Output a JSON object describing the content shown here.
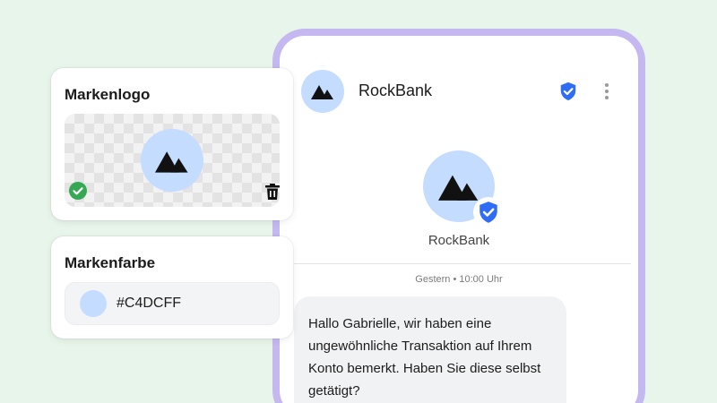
{
  "brand_logo_card": {
    "title": "Markenlogo"
  },
  "brand_color_card": {
    "title": "Markenfarbe",
    "value": "#C4DCFF"
  },
  "chat": {
    "header_name": "RockBank",
    "profile_name": "RockBank",
    "timestamp": "Gestern • 10:00 Uhr",
    "message": "Hallo Gabrielle, wir haben eine ungewöhnliche Transaktion auf Ihrem Konto bemerkt. Haben Sie diese selbst getätigt?"
  },
  "colors": {
    "background": "#e8f5ea",
    "phone_frame": "#c5b8f0",
    "brand_color": "#c4dcff",
    "verified_blue": "#2f6df6",
    "check_green": "#34a853",
    "bubble": "#f1f2f4"
  },
  "icons": {
    "logo": "mountain-icon",
    "verified": "verified-shield-icon",
    "more": "kebab-menu-icon",
    "check": "check-circle-icon",
    "delete": "trash-icon"
  }
}
